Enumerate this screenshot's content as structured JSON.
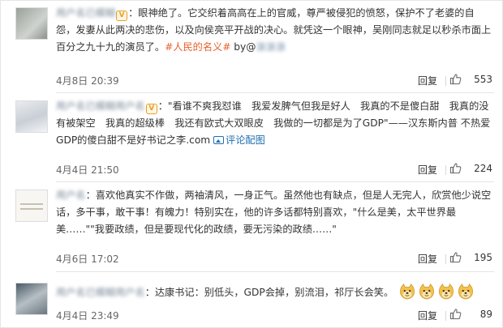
{
  "comments": [
    {
      "username": "用户名已模糊",
      "badge": "V",
      "content": "：眼神绝了。它交织着高高在上的官威，尊严被侵犯的愤怒，保护不了老婆的自怨，发妻从此两决的悲伤，以及向侯亮平开战的决心。就凭这一个眼神，吴刚同志就足以秒杀市面上百分之九十九的演员了。",
      "hashtag": "#人民的名义#",
      "by": " by@",
      "by_name": "涂涂涂",
      "date": "4月8日 20:39",
      "reply": "回复",
      "likes": "553"
    },
    {
      "username": "用户名已模糊用户名",
      "badge": "V",
      "content": "：\"看谁不爽我怼谁　我爱发脾气但我是好人　我真的不是傻白甜　我真的没有被架空　我真的超级棒　我还有欧式大双眼皮　我做的一切都是为了GDP\"——汉东斯内普 不热爱GDP的傻白甜不是好书记之李.com",
      "pic_link": "评论配图",
      "date": "4月4日 21:50",
      "reply": "回复",
      "likes": "224"
    },
    {
      "username": "用户名",
      "content": "：喜欢他真实不作做，两袖清风，一身正气。虽然他也有缺点，但是人无完人，欣赏他少说空话，多干事，敢干事！有魄力！特别实在，他的许多话都特别喜欢，\"什么是美，太平世界最美……\"\"我要政绩，但是要现代化的政绩，要无污染的政绩……\"",
      "date": "4月6日 17:02",
      "reply": "回复",
      "likes": "195"
    },
    {
      "username": "用户名已模糊用户名",
      "content": "：达康书记：别低头，GDP会掉，别流泪，祁厅长会笑。",
      "emojis": [
        "doge",
        "doge",
        "doge",
        "doge"
      ],
      "date": "4月4日 23:49",
      "reply": "回复",
      "likes": "89"
    }
  ],
  "icons": {
    "like": "thumbs-up-icon",
    "emoji": "doge-emoji-icon",
    "pic": "picture-icon"
  },
  "colors": {
    "hashtag": "#e8602a",
    "link": "#1f6fb2",
    "badge": "#e8a026",
    "meta": "#666666"
  }
}
